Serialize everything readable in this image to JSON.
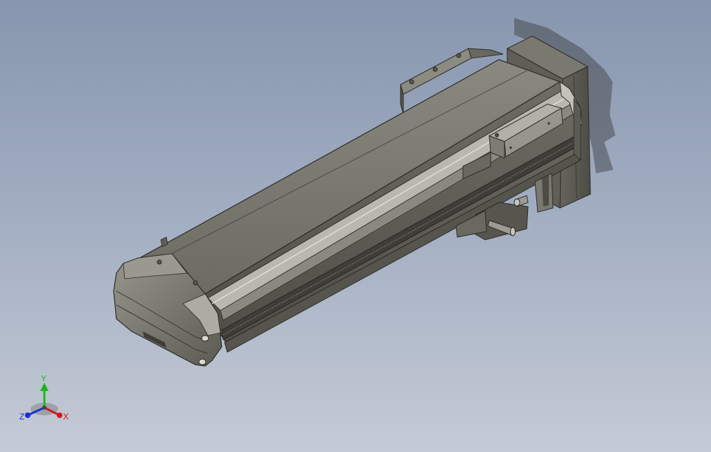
{
  "viewport": {
    "background_top": "#8796ae",
    "background_bottom": "#c5cbd6"
  },
  "model": {
    "name": "linear-actuator-module",
    "body_color": "#75746a",
    "rail_color": "#b9b8b0",
    "edge_color": "#2a2a26"
  },
  "triad": {
    "x_label": "X",
    "y_label": "Y",
    "z_label": "Z",
    "x_color": "#d01818",
    "y_color": "#18b818",
    "z_color": "#1830d0"
  }
}
